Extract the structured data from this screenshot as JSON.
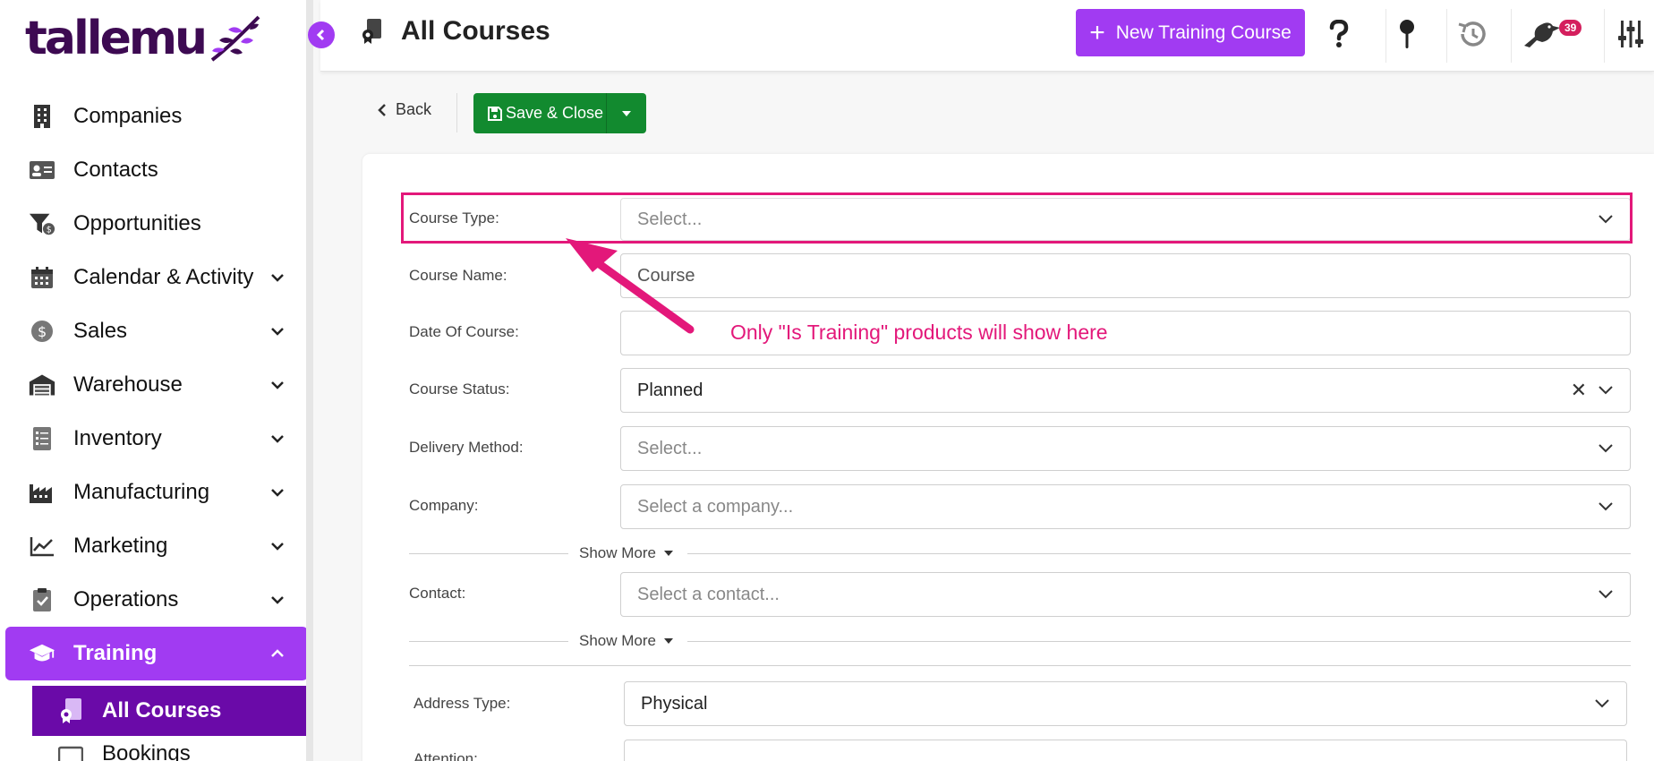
{
  "app": {
    "logo_text": "tallemu"
  },
  "sidebar": {
    "items": [
      {
        "label": "Companies"
      },
      {
        "label": "Contacts"
      },
      {
        "label": "Opportunities"
      },
      {
        "label": "Calendar & Activity"
      },
      {
        "label": "Sales"
      },
      {
        "label": "Warehouse"
      },
      {
        "label": "Inventory"
      },
      {
        "label": "Manufacturing"
      },
      {
        "label": "Marketing"
      },
      {
        "label": "Operations"
      },
      {
        "label": "Training"
      }
    ],
    "sub_items": [
      {
        "label": "All Courses"
      },
      {
        "label": "Bookings"
      }
    ]
  },
  "header": {
    "title": "All Courses",
    "new_button": "New Training Course",
    "notification_count": "39"
  },
  "toolbar": {
    "back_label": "Back",
    "save_label": "Save & Close"
  },
  "form": {
    "course_type": {
      "label": "Course Type:",
      "placeholder": "Select..."
    },
    "course_name": {
      "label": "Course Name:",
      "value": "Course"
    },
    "date_of_course": {
      "label": "Date Of Course:",
      "value": ""
    },
    "course_status": {
      "label": "Course Status:",
      "value": "Planned"
    },
    "delivery_method": {
      "label": "Delivery Method:",
      "placeholder": "Select..."
    },
    "company": {
      "label": "Company:",
      "placeholder": "Select a company..."
    },
    "show_more_1": "Show More",
    "contact": {
      "label": "Contact:",
      "placeholder": "Select a contact..."
    },
    "show_more_2": "Show More",
    "address_type": {
      "label": "Address Type:",
      "value": "Physical"
    },
    "attention": {
      "label": "Attention:"
    }
  },
  "annotation": {
    "text": "Only \"Is Training\" products will show here",
    "color": "#e3187a"
  },
  "colors": {
    "brand": "#a13bf2",
    "brand_dark": "#6a0aa8",
    "save_green": "#128a2f",
    "logo": "#3d0a52"
  }
}
